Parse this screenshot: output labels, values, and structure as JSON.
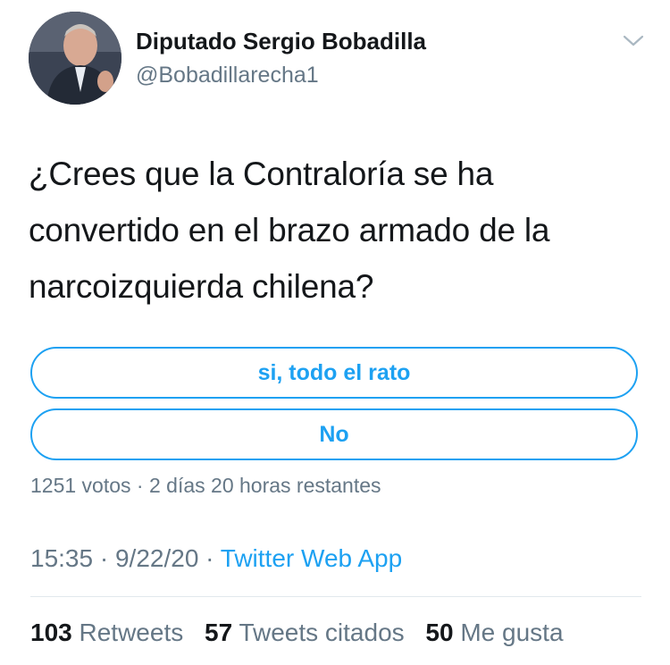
{
  "author": {
    "name": "Diputado Sergio Bobadilla",
    "handle": "@Bobadillarecha1"
  },
  "tweet": {
    "text": "¿Crees que la Contraloría se ha convertido en el brazo armado de la narcoizquierda chilena?"
  },
  "poll": {
    "options": [
      "si, todo el rato",
      "No"
    ],
    "votes": "1251 votos",
    "separator": "·",
    "time_left": "2 días 20 horas restantes"
  },
  "meta": {
    "time": "15:35",
    "date": "9/22/20",
    "separator": "·",
    "app": "Twitter Web App"
  },
  "stats": {
    "retweets_count": "103",
    "retweets_label": "Retweets",
    "quotes_count": "57",
    "quotes_label": "Tweets citados",
    "likes_count": "50",
    "likes_label": "Me gusta"
  },
  "colors": {
    "accent": "#1da1f2",
    "secondary_text": "#657786",
    "primary_text": "#14171a"
  },
  "icons": [
    "avatar",
    "chevron-down-icon"
  ]
}
